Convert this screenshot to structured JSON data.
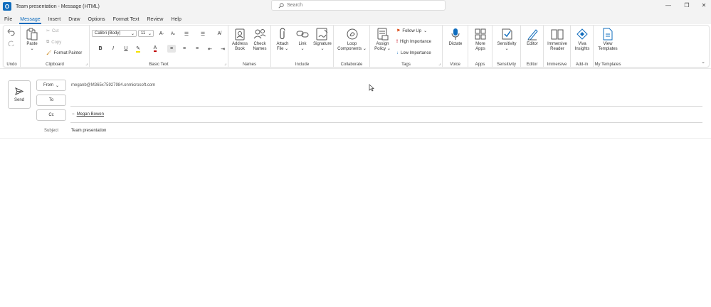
{
  "window": {
    "title": "Team presentation - Message (HTML)",
    "app_icon_letter": "O",
    "minimize": "—",
    "restore": "❐",
    "close": "✕"
  },
  "search": {
    "placeholder": "Search"
  },
  "menu": [
    "File",
    "Message",
    "Insert",
    "Draw",
    "Options",
    "Format Text",
    "Review",
    "Help"
  ],
  "ribbon": {
    "undo": {
      "label": "Undo"
    },
    "clipboard": {
      "label": "Clipboard",
      "paste": "Paste",
      "cut": "Cut",
      "copy": "Copy",
      "format_painter": "Format Painter"
    },
    "basic_text": {
      "label": "Basic Text",
      "font": "Calibri (Body)",
      "size": "11",
      "bold": "B",
      "italic": "I",
      "underline": "U"
    },
    "names": {
      "label": "Names",
      "address_book": "Address Book",
      "check_names": "Check Names"
    },
    "include": {
      "label": "Include",
      "attach_file": "Attach File",
      "link": "Link",
      "signature": "Signature"
    },
    "collaborate": {
      "label": "Collaborate",
      "loop_components": "Loop Components"
    },
    "tags": {
      "label": "Tags",
      "assign_policy": "Assign Policy",
      "follow_up": "Follow Up",
      "high_importance": "High Importance",
      "low_importance": "Low Importance"
    },
    "voice": {
      "label": "Voice",
      "dictate": "Dictate"
    },
    "apps": {
      "label": "Apps",
      "more_apps": "More Apps"
    },
    "sensitivity": {
      "label": "Sensitivity",
      "button": "Sensitivity"
    },
    "editor": {
      "label": "Editor",
      "button": "Editor"
    },
    "immersive": {
      "label": "Immersive",
      "button": "Immersive Reader"
    },
    "addin": {
      "label": "Add-in",
      "button": "Viva Insights"
    },
    "templates": {
      "label": "My Templates",
      "button": "View Templates"
    }
  },
  "compose": {
    "send": "Send",
    "from_label": "From",
    "from_value": "meganb@M365x75927984.onmicrosoft.com",
    "to_label": "To",
    "to_value": "",
    "cc_label": "Cc",
    "cc_value": "Megan Bowen",
    "subject_label": "Subject",
    "subject_value": "Team presentation"
  },
  "colors": {
    "accent": "#0f6cbd"
  }
}
